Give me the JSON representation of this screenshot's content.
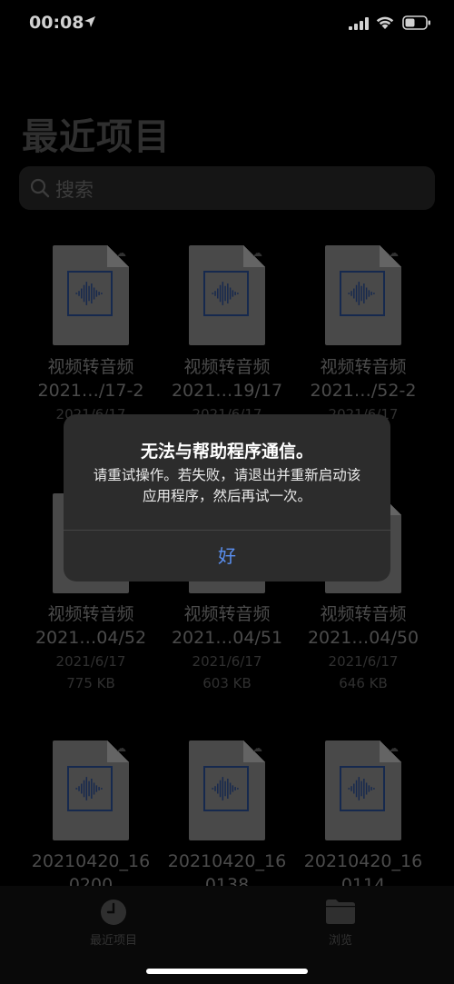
{
  "status_bar": {
    "time": "00:08",
    "icons": [
      "location-arrow-icon",
      "cell-signal-icon",
      "wifi-icon",
      "battery-icon"
    ]
  },
  "header": {
    "title": "最近项目"
  },
  "search": {
    "placeholder": "搜索",
    "icon": "search-icon"
  },
  "files": [
    {
      "name1": "视频转音频",
      "name2": "2021…/17-2",
      "date": "2021/6/17",
      "size": ""
    },
    {
      "name1": "视频转音频",
      "name2": "2021…19/17",
      "date": "2021/6/17",
      "size": ""
    },
    {
      "name1": "视频转音频",
      "name2": "2021…/52-2",
      "date": "2021/6/17",
      "size": ""
    },
    {
      "name1": "视频转音频",
      "name2": "2021…04/52",
      "date": "2021/6/17",
      "size": "775 KB"
    },
    {
      "name1": "视频转音频",
      "name2": "2021…04/51",
      "date": "2021/6/17",
      "size": "603 KB"
    },
    {
      "name1": "视频转音频",
      "name2": "2021…04/50",
      "date": "2021/6/17",
      "size": "646 KB"
    },
    {
      "name1": "20210420_16",
      "name2": "0200",
      "date": "",
      "size": ""
    },
    {
      "name1": "20210420_16",
      "name2": "0138",
      "date": "",
      "size": ""
    },
    {
      "name1": "20210420_16",
      "name2": "0114",
      "date": "",
      "size": ""
    }
  ],
  "alert": {
    "title": "无法与帮助程序通信。",
    "message": "请重试操作。若失败，请退出并重新启动该应用程序，然后再试一次。",
    "button": "好"
  },
  "tab_bar": {
    "recent_label": "最近项目",
    "recent_icon": "clock-icon",
    "browse_label": "浏览",
    "browse_icon": "folder-icon"
  },
  "colors": {
    "accent": "#5a8ff0",
    "alert_bg": "#2c2c2c",
    "background": "#000000"
  }
}
